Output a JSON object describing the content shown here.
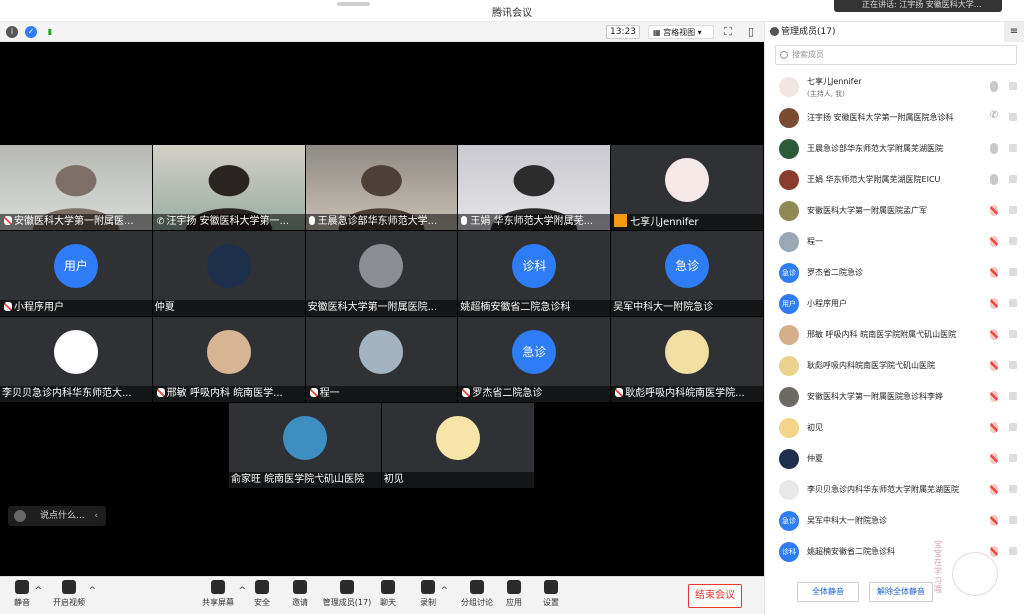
{
  "window": {
    "title": "腾讯会议",
    "notice": "正在讲话: 江宇扬 安徽医科大学..."
  },
  "toolbar": {
    "time": "13:23",
    "view_mode": "宫格视图"
  },
  "tiles": [
    {
      "name": "安徽医科大学第一附属医...",
      "icon": "mic-muted",
      "kind": "video",
      "palette": [
        "#b7b8b4",
        "#d9dcd9",
        "#7c7066"
      ]
    },
    {
      "name": "汪宇扬 安徽医科大学第一...",
      "icon": "phone",
      "kind": "video",
      "palette": [
        "#d3d0c8",
        "#9aaca2",
        "#2a2522"
      ]
    },
    {
      "name": "王晨急诊部华东师范大学...",
      "icon": "mic",
      "kind": "video",
      "palette": [
        "#8f8a85",
        "#c9c1b6",
        "#4d4037"
      ]
    },
    {
      "name": "王娟 华东师范大学附属芜...",
      "icon": "mic",
      "kind": "video",
      "palette": [
        "#c9c9cf",
        "#e4e4e8",
        "#2c2c2c"
      ]
    },
    {
      "name": "七享儿Jennifer",
      "icon": "orange",
      "kind": "avatar",
      "avatar_color": "#f5e8e6"
    },
    {
      "name": "小程序用户",
      "icon": "mic-muted",
      "kind": "blue",
      "avatar_text": "用户"
    },
    {
      "name": "仲夏",
      "icon": "",
      "kind": "avatar",
      "avatar_color": "#1d2f4a"
    },
    {
      "name": "安徽医科大学第一附属医院...",
      "icon": "",
      "kind": "avatar",
      "avatar_color": "#8b8f93"
    },
    {
      "name": "姚超楠安徽省二院急诊科",
      "icon": "",
      "kind": "blue",
      "avatar_text": "诊科"
    },
    {
      "name": "吴军中科大一附院急诊",
      "icon": "",
      "kind": "blue",
      "avatar_text": "急诊"
    },
    {
      "name": "李贝贝急诊内科华东师范大...",
      "icon": "",
      "kind": "avatar",
      "avatar_color": "#ffffff"
    },
    {
      "name": "邢敏 呼吸内科 皖南医学...",
      "icon": "mic-muted",
      "kind": "avatar",
      "avatar_color": "#d7b592"
    },
    {
      "name": "程一",
      "icon": "mic-muted",
      "kind": "avatar",
      "avatar_color": "#a3b3c2"
    },
    {
      "name": "罗杰省二院急诊",
      "icon": "mic-muted",
      "kind": "blue",
      "avatar_text": "急诊"
    },
    {
      "name": "耿彪呼吸内科皖南医学院...",
      "icon": "mic-muted",
      "kind": "avatar",
      "avatar_color": "#f2dfa1"
    },
    {
      "name": "俞家旺 皖南医学院弋矶山医院",
      "icon": "",
      "kind": "avatar",
      "avatar_color": "#3d8fc2"
    },
    {
      "name": "初见",
      "icon": "",
      "kind": "avatar",
      "avatar_color": "#f7e4a8"
    }
  ],
  "chat": {
    "placeholder": "说点什么...",
    "chevron": "‹"
  },
  "bottombar": {
    "buttons": [
      {
        "label": "静音",
        "name": "mute-button"
      },
      {
        "label": "开启视频",
        "name": "start-video-button"
      },
      {
        "label": "共享屏幕",
        "name": "share-screen-button"
      },
      {
        "label": "安全",
        "name": "security-button"
      },
      {
        "label": "邀请",
        "name": "invite-button"
      },
      {
        "label": "管理成员(17)",
        "name": "manage-members-button"
      },
      {
        "label": "聊天",
        "name": "chat-button"
      },
      {
        "label": "录制",
        "name": "record-button"
      },
      {
        "label": "分组讨论",
        "name": "breakout-button"
      },
      {
        "label": "应用",
        "name": "apps-button"
      },
      {
        "label": "设置",
        "name": "settings-button"
      }
    ],
    "end_label": "结束会议"
  },
  "panel": {
    "title": "管理成员(17)",
    "search_placeholder": "搜索成员",
    "members": [
      {
        "name": "七享儿Jennifer",
        "sub": "(主持人, 我)",
        "avatar_color": "#f3e5e2",
        "status": "mic"
      },
      {
        "name": "汪宇扬 安徽医科大学第一附属医院急诊科",
        "sub": "",
        "avatar_color": "#7a4a33",
        "status": "phone"
      },
      {
        "name": "王晨急诊部华东师范大学附属芜湖医院",
        "sub": "",
        "avatar_color": "#2f5a3a",
        "status": "mic"
      },
      {
        "name": "王娟 华东师范大学附属芜湖医院EICU",
        "sub": "",
        "avatar_color": "#8a3b2e",
        "status": "mic"
      },
      {
        "name": "安徽医科大学第一附属医院孟广军",
        "sub": "",
        "avatar_color": "#8f8a55",
        "status": "muted"
      },
      {
        "name": "程一",
        "sub": "",
        "avatar_color": "#9aa8b6",
        "status": "muted"
      },
      {
        "name": "罗杰省二院急诊",
        "sub": "",
        "avatar_color": "#2e7cf6",
        "avatar_text": "急诊",
        "status": "muted"
      },
      {
        "name": "小程序用户",
        "sub": "",
        "avatar_color": "#2e7cf6",
        "avatar_text": "用户",
        "status": "muted"
      },
      {
        "name": "邢敏 呼吸内科 皖南医学院附属弋矶山医院",
        "sub": "",
        "avatar_color": "#d2b08a",
        "status": "muted"
      },
      {
        "name": "耿彪呼吸内科皖南医学院弋矶山医院",
        "sub": "",
        "avatar_color": "#e9d38e",
        "status": "muted"
      },
      {
        "name": "安徽医科大学第一附属医院急诊科李婷",
        "sub": "",
        "avatar_color": "#6d6a66",
        "status": "muted"
      },
      {
        "name": "初见",
        "sub": "",
        "avatar_color": "#f2d58a",
        "status": "muted"
      },
      {
        "name": "仲夏",
        "sub": "",
        "avatar_color": "#1d2f4a",
        "status": "muted"
      },
      {
        "name": "李贝贝急诊内科华东师范大学附属芜湖医院",
        "sub": "",
        "avatar_color": "#e8e8e8",
        "status": "muted"
      },
      {
        "name": "吴军中科大一附院急诊",
        "sub": "",
        "avatar_color": "#2e7cf6",
        "avatar_text": "急诊",
        "status": "muted"
      },
      {
        "name": "姚超楠安徽省二院急诊科",
        "sub": "",
        "avatar_color": "#2e7cf6",
        "avatar_text": "诊科",
        "status": "muted"
      }
    ],
    "mute_all": "全体静音",
    "unmute_all": "解除全体静音",
    "mascot_text": "宝宝在学习哦"
  },
  "colors": {
    "accent": "#2e7cf6",
    "danger": "#f0483e",
    "stage": "#000000",
    "tile": "#2f3134"
  }
}
